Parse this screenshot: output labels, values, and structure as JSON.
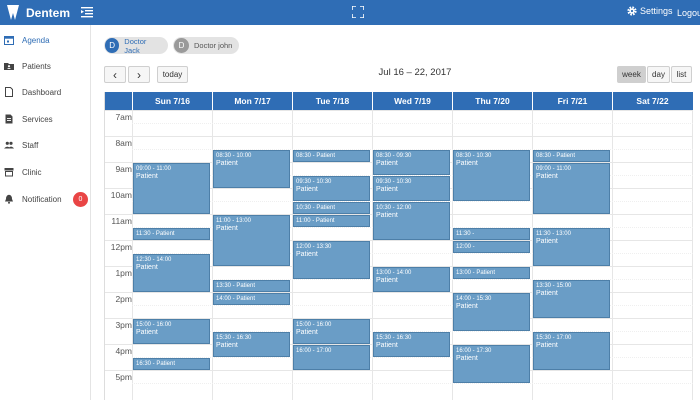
{
  "app": {
    "name": "Dentem"
  },
  "topbar": {
    "settings_label": "Settings",
    "logout_label": "Logout"
  },
  "sidebar": {
    "items": [
      {
        "label": "Agenda",
        "icon": "calendar-icon",
        "active": true
      },
      {
        "label": "Patients",
        "icon": "folder-user-icon"
      },
      {
        "label": "Dashboard",
        "icon": "document-icon"
      },
      {
        "label": "Services",
        "icon": "document-list-icon"
      },
      {
        "label": "Staff",
        "icon": "users-icon"
      },
      {
        "label": "Clinic",
        "icon": "store-icon"
      },
      {
        "label": "Notification",
        "icon": "bell-icon",
        "badge": "0"
      }
    ]
  },
  "doctors": [
    {
      "initial": "D",
      "name": "Doctor Jack",
      "selected": true
    },
    {
      "initial": "D",
      "name": "Doctor john",
      "selected": false
    }
  ],
  "toolbar": {
    "prev": "‹",
    "next": "›",
    "today": "today",
    "title": "Jul 16 – 22, 2017",
    "views": [
      "week",
      "day",
      "list"
    ],
    "active_view": "week"
  },
  "calendar": {
    "days": [
      "Sun 7/16",
      "Mon 7/17",
      "Tue 7/18",
      "Wed 7/19",
      "Thu 7/20",
      "Fri 7/21",
      "Sat 7/22"
    ],
    "hours": [
      "7am",
      "8am",
      "9am",
      "10am",
      "11am",
      "12pm",
      "1pm",
      "2pm",
      "3pm",
      "4pm",
      "5pm"
    ],
    "events": [
      {
        "day": 0,
        "start": 9.0,
        "end": 11.0,
        "time": "09:00 - 11:00",
        "title": "Patient"
      },
      {
        "day": 0,
        "start": 11.5,
        "end": 12.0,
        "time": "11:30 - Patient",
        "title": ""
      },
      {
        "day": 0,
        "start": 12.5,
        "end": 14.0,
        "time": "12:30 - 14:00",
        "title": "Patient"
      },
      {
        "day": 0,
        "start": 15.0,
        "end": 16.0,
        "time": "15:00 - 16:00",
        "title": "Patient"
      },
      {
        "day": 0,
        "start": 16.5,
        "end": 17.0,
        "time": "16:30 - Patient",
        "title": ""
      },
      {
        "day": 1,
        "start": 8.5,
        "end": 10.0,
        "time": "08:30 - 10:00",
        "title": "Patient"
      },
      {
        "day": 1,
        "start": 11.0,
        "end": 13.0,
        "time": "11:00 - 13:00",
        "title": "Patient"
      },
      {
        "day": 1,
        "start": 13.5,
        "end": 14.0,
        "time": "13:30 - Patient",
        "title": ""
      },
      {
        "day": 1,
        "start": 14.0,
        "end": 14.5,
        "time": "14:00 - Patient",
        "title": ""
      },
      {
        "day": 1,
        "start": 15.5,
        "end": 16.5,
        "time": "15:30 - 16:30",
        "title": "Patient"
      },
      {
        "day": 2,
        "start": 8.5,
        "end": 9.0,
        "time": "08:30 - Patient",
        "title": ""
      },
      {
        "day": 2,
        "start": 9.5,
        "end": 10.5,
        "time": "09:30 - 10:30",
        "title": "Patient"
      },
      {
        "day": 2,
        "start": 10.5,
        "end": 11.0,
        "time": "10:30 - Patient",
        "title": ""
      },
      {
        "day": 2,
        "start": 11.0,
        "end": 11.5,
        "time": "11:00 - Patient",
        "title": ""
      },
      {
        "day": 2,
        "start": 12.0,
        "end": 13.5,
        "time": "12:00 - 13:30",
        "title": "Patient"
      },
      {
        "day": 2,
        "start": 15.0,
        "end": 16.0,
        "time": "15:00 - 16:00",
        "title": "Patient"
      },
      {
        "day": 2,
        "start": 16.0,
        "end": 17.0,
        "time": "16:00 - 17:00",
        "title": ""
      },
      {
        "day": 3,
        "start": 8.5,
        "end": 9.5,
        "time": "08:30 - 09:30",
        "title": "Patient"
      },
      {
        "day": 3,
        "start": 9.5,
        "end": 10.5,
        "time": "09:30 - 10:30",
        "title": "Patient"
      },
      {
        "day": 3,
        "start": 10.5,
        "end": 12.0,
        "time": "10:30 - 12:00",
        "title": "Patient"
      },
      {
        "day": 3,
        "start": 13.0,
        "end": 14.0,
        "time": "13:00 - 14:00",
        "title": "Patient"
      },
      {
        "day": 3,
        "start": 15.5,
        "end": 16.5,
        "time": "15:30 - 16:30",
        "title": "Patient"
      },
      {
        "day": 4,
        "start": 8.5,
        "end": 10.5,
        "time": "08:30 - 10:30",
        "title": "Patient"
      },
      {
        "day": 4,
        "start": 11.5,
        "end": 12.0,
        "time": "11:30 -",
        "title": ""
      },
      {
        "day": 4,
        "start": 12.0,
        "end": 12.5,
        "time": "12:00 -",
        "title": ""
      },
      {
        "day": 4,
        "start": 13.0,
        "end": 13.5,
        "time": "13:00 - Patient",
        "title": ""
      },
      {
        "day": 4,
        "start": 14.0,
        "end": 15.5,
        "time": "14:00 - 15:30",
        "title": "Patient"
      },
      {
        "day": 4,
        "start": 16.0,
        "end": 17.5,
        "time": "16:00 - 17:30",
        "title": "Patient"
      },
      {
        "day": 5,
        "start": 8.5,
        "end": 9.0,
        "time": "08:30 - Patient",
        "title": ""
      },
      {
        "day": 5,
        "start": 9.0,
        "end": 11.0,
        "time": "09:00 - 11:00",
        "title": "Patient"
      },
      {
        "day": 5,
        "start": 11.5,
        "end": 13.0,
        "time": "11:30 - 13:00",
        "title": "Patient"
      },
      {
        "day": 5,
        "start": 13.5,
        "end": 15.0,
        "time": "13:30 - 15:00",
        "title": "Patient"
      },
      {
        "day": 5,
        "start": 15.5,
        "end": 17.0,
        "time": "15:30 - 17:00",
        "title": "Patient"
      }
    ]
  },
  "colors": {
    "brand": "#2f6db5",
    "event_fill": "#6a9dc6",
    "event_border": "#4d7fa8",
    "badge": "#e94545"
  }
}
